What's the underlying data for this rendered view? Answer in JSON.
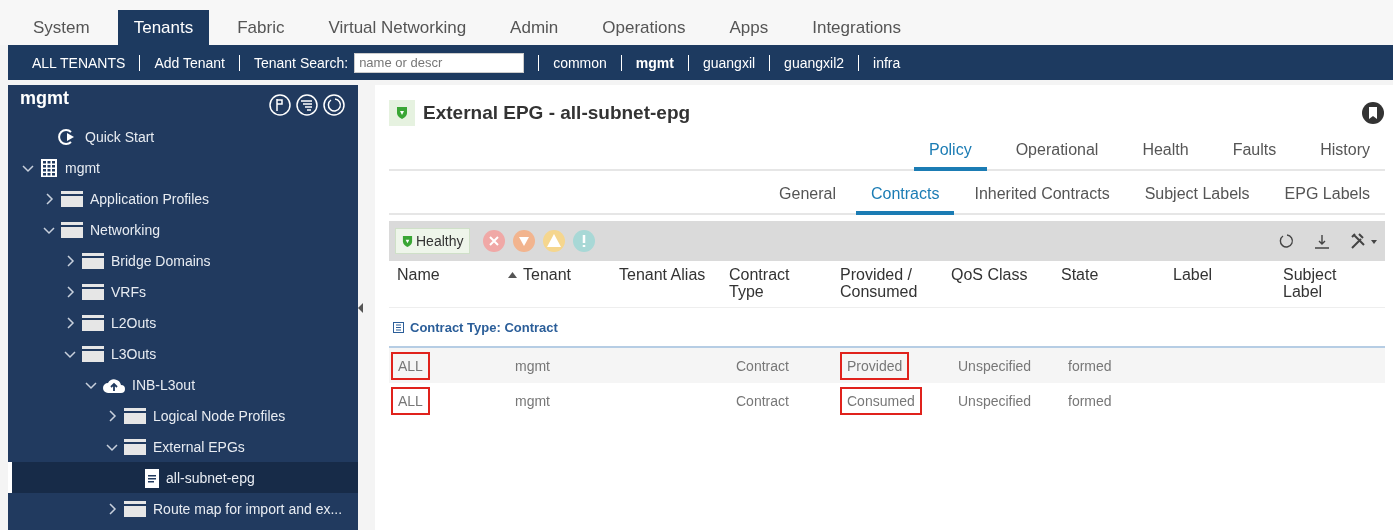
{
  "top_tabs": [
    {
      "label": "System",
      "selected": false
    },
    {
      "label": "Tenants",
      "selected": true
    },
    {
      "label": "Fabric",
      "selected": false
    },
    {
      "label": "Virtual Networking",
      "selected": false
    },
    {
      "label": "Admin",
      "selected": false
    },
    {
      "label": "Operations",
      "selected": false
    },
    {
      "label": "Apps",
      "selected": false
    },
    {
      "label": "Integrations",
      "selected": false
    }
  ],
  "tenant_bar": {
    "links": [
      "ALL TENANTS",
      "Add Tenant"
    ],
    "search_label": "Tenant Search:",
    "search": {
      "placeholder": "name or descr"
    },
    "tenants": [
      {
        "label": "common",
        "selected": false
      },
      {
        "label": "mgmt",
        "selected": true
      },
      {
        "label": "guangxil",
        "selected": false
      },
      {
        "label": "guangxil2",
        "selected": false
      },
      {
        "label": "infra",
        "selected": false
      }
    ]
  },
  "sidebar": {
    "title": "mgmt",
    "tree": [
      {
        "label": "Quick Start",
        "kind": "quickstart",
        "selected": false
      },
      {
        "label": "mgmt",
        "kind": "tenant",
        "expanded": true,
        "selected": false,
        "children": [
          {
            "label": "Application Profiles",
            "kind": "folder",
            "expanded": false,
            "selected": false
          },
          {
            "label": "Networking",
            "kind": "folder",
            "expanded": true,
            "selected": false,
            "children": [
              {
                "label": "Bridge Domains",
                "kind": "folder",
                "expanded": false,
                "selected": false
              },
              {
                "label": "VRFs",
                "kind": "folder",
                "expanded": false,
                "selected": false
              },
              {
                "label": "L2Outs",
                "kind": "folder",
                "expanded": false,
                "selected": false
              },
              {
                "label": "L3Outs",
                "kind": "folder",
                "expanded": true,
                "selected": false,
                "children": [
                  {
                    "label": "INB-L3out",
                    "kind": "cloud",
                    "expanded": true,
                    "selected": false,
                    "children": [
                      {
                        "label": "Logical Node Profiles",
                        "kind": "folder",
                        "expanded": false,
                        "selected": false
                      },
                      {
                        "label": "External EPGs",
                        "kind": "folder",
                        "expanded": true,
                        "selected": false,
                        "children": [
                          {
                            "label": "all-subnet-epg",
                            "kind": "document",
                            "selected": true
                          }
                        ]
                      },
                      {
                        "label": "Route map for import and ex...",
                        "kind": "folder",
                        "expanded": false,
                        "selected": false
                      }
                    ]
                  }
                ]
              }
            ]
          }
        ]
      }
    ]
  },
  "panel": {
    "title": "External EPG - all-subnet-epg",
    "tabs": [
      {
        "label": "Policy",
        "selected": true
      },
      {
        "label": "Operational",
        "selected": false
      },
      {
        "label": "Health",
        "selected": false
      },
      {
        "label": "Faults",
        "selected": false
      },
      {
        "label": "History",
        "selected": false
      }
    ],
    "subtabs": [
      {
        "label": "General",
        "selected": false
      },
      {
        "label": "Contracts",
        "selected": true
      },
      {
        "label": "Inherited Contracts",
        "selected": false
      },
      {
        "label": "Subject Labels",
        "selected": false
      },
      {
        "label": "EPG Labels",
        "selected": false
      }
    ],
    "health": "Healthy",
    "table": {
      "columns": [
        {
          "label": "Name",
          "sorted": false
        },
        {
          "label": "Tenant",
          "sorted": true
        },
        {
          "label": "Tenant Alias",
          "sorted": false
        },
        {
          "label": "Contract Type",
          "sorted": false
        },
        {
          "label": "Provided / Consumed",
          "sorted": false
        },
        {
          "label": "QoS Class",
          "sorted": false
        },
        {
          "label": "State",
          "sorted": false
        },
        {
          "label": "Label",
          "sorted": false
        },
        {
          "label": "Subject Label",
          "sorted": false
        }
      ],
      "group": "Contract Type: Contract",
      "rows": [
        {
          "cells": [
            {
              "text": "ALL",
              "boxed": true
            },
            {
              "text": "mgmt",
              "boxed": false
            },
            {
              "text": "",
              "boxed": false
            },
            {
              "text": "Contract",
              "boxed": false
            },
            {
              "text": "Provided",
              "boxed": true
            },
            {
              "text": "Unspecified",
              "boxed": false
            },
            {
              "text": "formed",
              "boxed": false
            },
            {
              "text": "",
              "boxed": false
            },
            {
              "text": "",
              "boxed": false
            }
          ]
        },
        {
          "cells": [
            {
              "text": "ALL",
              "boxed": true
            },
            {
              "text": "mgmt",
              "boxed": false
            },
            {
              "text": "",
              "boxed": false
            },
            {
              "text": "Contract",
              "boxed": false
            },
            {
              "text": "Consumed",
              "boxed": true
            },
            {
              "text": "Unspecified",
              "boxed": false
            },
            {
              "text": "formed",
              "boxed": false
            },
            {
              "text": "",
              "boxed": false
            },
            {
              "text": "",
              "boxed": false
            }
          ]
        }
      ]
    }
  }
}
